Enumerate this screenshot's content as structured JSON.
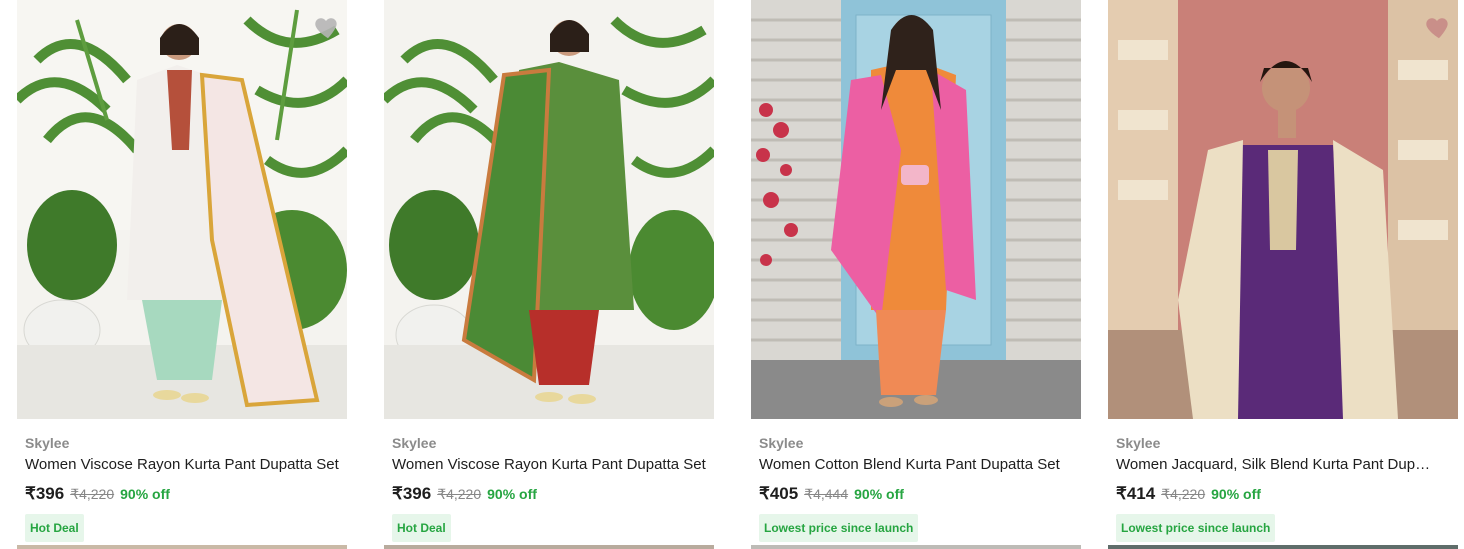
{
  "products": [
    {
      "brand": "Skylee",
      "title": "Women Viscose Rayon Kurta Pant Dupatta Set",
      "price": "₹396",
      "mrp": "₹4,220",
      "discount": "90% off",
      "badge": "Hot Deal"
    },
    {
      "brand": "Skylee",
      "title": "Women Viscose Rayon Kurta Pant Dupatta Set",
      "price": "₹396",
      "mrp": "₹4,220",
      "discount": "90% off",
      "badge": "Hot Deal"
    },
    {
      "brand": "Skylee",
      "title": "Women Cotton Blend Kurta Pant Dupatta Set",
      "price": "₹405",
      "mrp": "₹4,444",
      "discount": "90% off",
      "badge": "Lowest price since launch"
    },
    {
      "brand": "Skylee",
      "title": "Women Jacquard, Silk Blend Kurta Pant Dupatta Set",
      "price": "₹414",
      "mrp": "₹4,220",
      "discount": "90% off",
      "badge": "Lowest price since launch"
    }
  ],
  "icons": {
    "wishlist": "heart-icon"
  },
  "colors": {
    "accent_green": "#26a541",
    "badge_bg": "#e6f6ea",
    "heart": "#b5b5b5"
  }
}
